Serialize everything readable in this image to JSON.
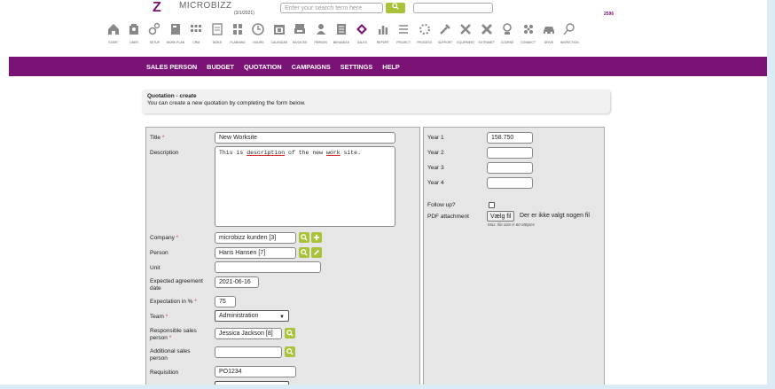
{
  "header": {
    "logo_text": "MICROBIZZ",
    "logo_date": "(3/1/2021)",
    "search_placeholder": "Enter your search term here",
    "badge_count": "2596"
  },
  "iconbar": [
    {
      "label": "START",
      "icon": "home-icon"
    },
    {
      "label": "USER",
      "icon": "user-icon"
    },
    {
      "label": "SETUP",
      "icon": "setup-icon"
    },
    {
      "label": "WORK PLAN",
      "icon": "workplan-icon"
    },
    {
      "label": "CRM",
      "icon": "crm-icon"
    },
    {
      "label": "TASKS",
      "icon": "tasks-icon"
    },
    {
      "label": "PLANNING",
      "icon": "planning-icon"
    },
    {
      "label": "HOURS",
      "icon": "clock-icon"
    },
    {
      "label": "CALENDAR",
      "icon": "calendar-icon"
    },
    {
      "label": "INVOICES",
      "icon": "invoices-icon"
    },
    {
      "label": "PERSON",
      "icon": "person-icon"
    },
    {
      "label": "BEHANDLE",
      "icon": "behandle-icon"
    },
    {
      "label": "SALES",
      "icon": "sales-icon"
    },
    {
      "label": "REPORT",
      "icon": "report-icon"
    },
    {
      "label": "PROJECT",
      "icon": "project-icon"
    },
    {
      "label": "PROCESS",
      "icon": "process-icon"
    },
    {
      "label": "SUPPORT",
      "icon": "support-icon"
    },
    {
      "label": "EQUIPMENT",
      "icon": "equipment-icon"
    },
    {
      "label": "EXTRANET",
      "icon": "extranet-icon"
    },
    {
      "label": "COURSE",
      "icon": "course-icon"
    },
    {
      "label": "CONNECT",
      "icon": "connect-icon"
    },
    {
      "label": "DRIVE",
      "icon": "car-icon"
    },
    {
      "label": "INSPECTION",
      "icon": "inspection-icon"
    }
  ],
  "nav": [
    "SALES PERSON",
    "BUDGET",
    "QUOTATION",
    "CAMPAIGNS",
    "SETTINGS",
    "HELP"
  ],
  "info": {
    "title": "Quotation - create",
    "text": "You can create a new quotation by completing the form below."
  },
  "form": {
    "title_label": "Title",
    "title_value": "New Worksite",
    "description_label": "Description",
    "description_value_parts": [
      "This is ",
      "description",
      " of the new ",
      "work",
      " site."
    ],
    "company_label": "Company",
    "company_value": "microbizz kunden [3]",
    "person_label": "Person",
    "person_value": "Hans Hansen [7]",
    "unit_label": "Unit",
    "unit_value": "",
    "agreement_label": "Expected agreement date",
    "agreement_value": "2021-06-16",
    "expectation_label": "Expectation in %",
    "expectation_value": "75",
    "team_label": "Team",
    "team_value": "Administration",
    "responsible_label_1": "Responsible sales",
    "responsible_label_2": "person",
    "responsible_value": "Jessica Jackson [8]",
    "additional_label_1": "Additional sales",
    "additional_label_2": "person",
    "additional_value": "",
    "requisition_label": "Requisition",
    "requisition_value": "PO1234",
    "required_mark": "*"
  },
  "right": {
    "year1_label": "Year 1",
    "year1_value": "158.750",
    "year2_label": "Year 2",
    "year2_value": "",
    "year3_label": "Year 3",
    "year3_value": "",
    "year4_label": "Year 4",
    "year4_value": "",
    "followup_label": "Follow up?",
    "followup_checked": false,
    "pdf_label": "PDF attachment",
    "file_button": "Vælg fil",
    "file_text": "Der er ikke valgt nogen fil",
    "file_note": "Max. file size is 60 MBytes"
  },
  "colors": {
    "brand": "#7b1377",
    "accent_green": "#a8c33a",
    "required": "#dd3333"
  }
}
